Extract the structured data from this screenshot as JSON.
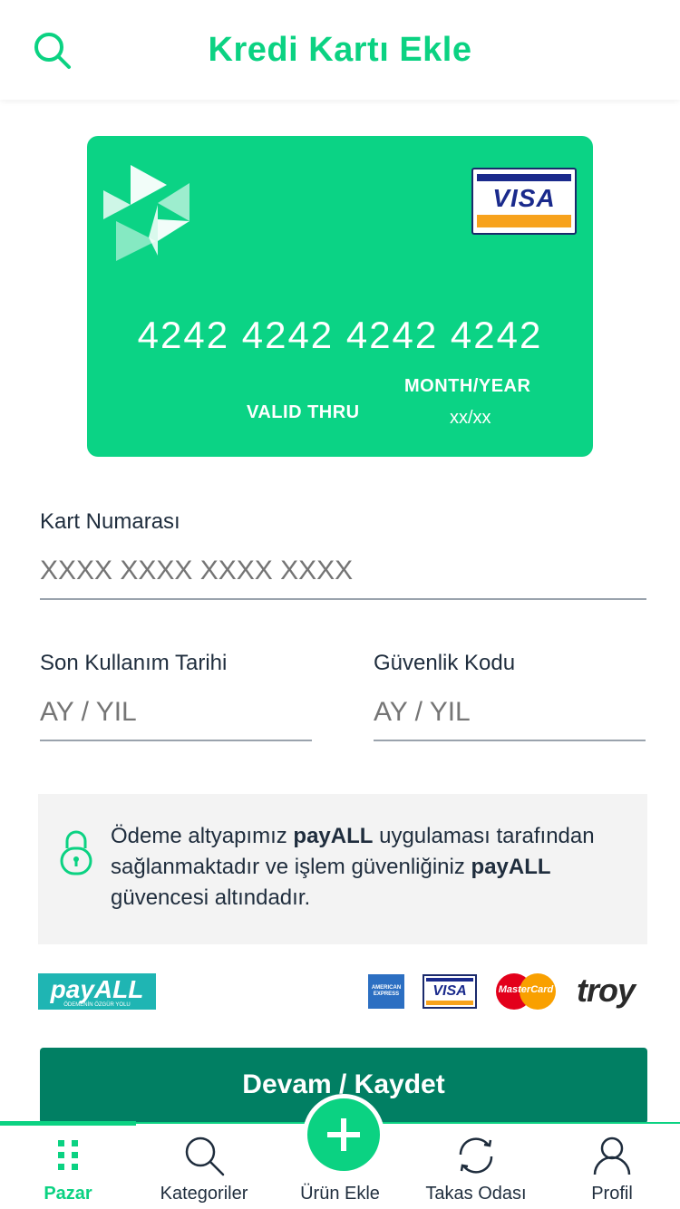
{
  "header": {
    "title": "Kredi Kartı Ekle",
    "search_icon": "search-icon"
  },
  "card": {
    "number": "4242 4242 4242 4242",
    "valid_thru": "VALID THRU",
    "month_year": "MONTH/YEAR",
    "expiry": "xx/xx",
    "brand": "VISA",
    "color": "#0bd385"
  },
  "form": {
    "card_number_label": "Kart Numarası",
    "card_number_placeholder": "XXXX XXXX XXXX XXXX",
    "expiry_label": "Son Kullanım Tarihi",
    "expiry_placeholder": "AY / YIL",
    "cvv_label": "Güvenlik Kodu",
    "cvv_placeholder": "AY / YIL"
  },
  "info": {
    "part1": "Ödeme altyapımız ",
    "brand1": "payALL",
    "part2": " uygulaması tarafından sağlanmaktadır ve işlem güvenliğiniz ",
    "brand2": "payALL",
    "part3": " güvencesi altındadır."
  },
  "brands": {
    "payall": "payALL",
    "payall_slogan": "ÖDEMENİN ÖZGÜR YOLU",
    "amex": "AMERICAN EXPRESS",
    "visa": "VISA",
    "mastercard": "MasterCard",
    "troy": "troy"
  },
  "actions": {
    "save_label": "Devam / Kaydet"
  },
  "tabbar": {
    "items": [
      {
        "label": "Pazar",
        "icon": "grid-icon",
        "active": true
      },
      {
        "label": "Kategoriler",
        "icon": "search-icon",
        "active": false
      },
      {
        "label": "Ürün Ekle",
        "icon": "plus-icon",
        "active": false
      },
      {
        "label": "Takas Odası",
        "icon": "refresh-icon",
        "active": false
      },
      {
        "label": "Profil",
        "icon": "user-icon",
        "active": false
      }
    ]
  },
  "colors": {
    "accent": "#0bd282",
    "button": "#017f63"
  }
}
